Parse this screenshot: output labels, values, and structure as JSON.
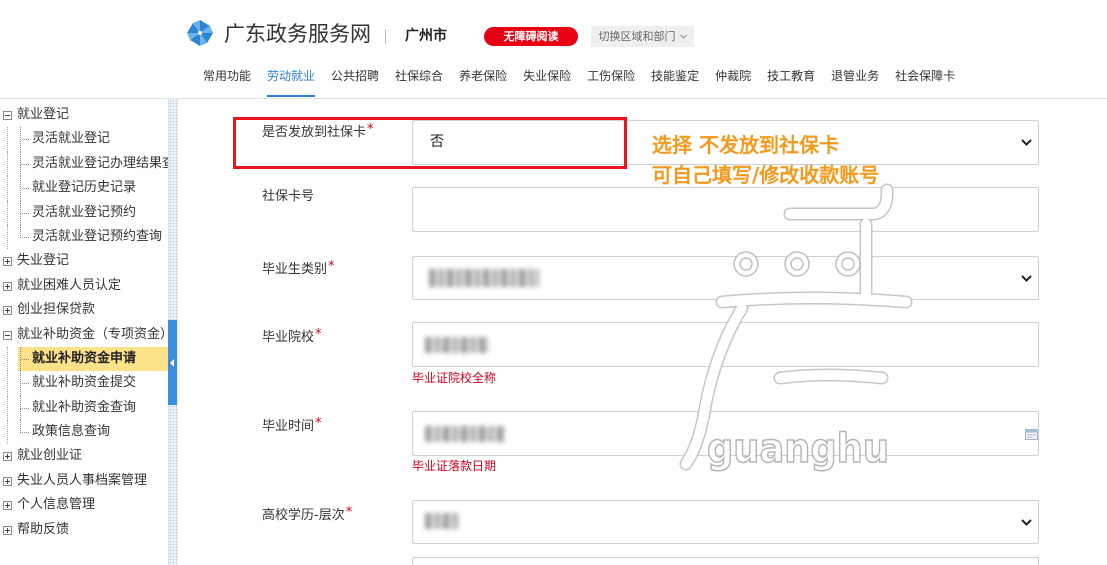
{
  "header": {
    "site_title": "广东政务服务网",
    "city": "广州市",
    "accessibility_label": "无障碍阅读",
    "region_switch_label": "切换区域和部门"
  },
  "nav": {
    "items": [
      "常用功能",
      "劳动就业",
      "公共招聘",
      "社保综合",
      "养老保险",
      "失业保险",
      "工伤保险",
      "技能鉴定",
      "仲裁院",
      "技工教育",
      "退管业务",
      "社会保障卡"
    ],
    "active_index": 1
  },
  "sidebar": {
    "groups": [
      {
        "label": "就业登记",
        "expanded": true,
        "children": [
          "灵活就业登记",
          "灵活就业登记办理结果查",
          "就业登记历史记录",
          "灵活就业登记预约",
          "灵活就业登记预约查询"
        ]
      },
      {
        "label": "失业登记",
        "expanded": false
      },
      {
        "label": "就业困难人员认定",
        "expanded": false
      },
      {
        "label": "创业担保贷款",
        "expanded": false
      },
      {
        "label": "就业补助资金（专项资金）",
        "expanded": true,
        "children": [
          "就业补助资金申请",
          "就业补助资金提交",
          "就业补助资金查询",
          "政策信息查询"
        ],
        "selected_index": 0
      },
      {
        "label": "就业创业证",
        "expanded": false
      },
      {
        "label": "失业人员人事档案管理",
        "expanded": false
      },
      {
        "label": "个人信息管理",
        "expanded": false
      },
      {
        "label": "帮助反馈",
        "expanded": false
      }
    ]
  },
  "form": {
    "required_mark": "*",
    "fields": [
      {
        "label": "是否发放到社保卡",
        "required": true,
        "value": "否"
      },
      {
        "label": "社保卡号",
        "required": false,
        "value": ""
      },
      {
        "label": "毕业生类别",
        "required": true
      },
      {
        "label": "毕业院校",
        "required": true,
        "hint": "毕业证院校全称"
      },
      {
        "label": "毕业时间",
        "required": true,
        "hint": "毕业证落款日期"
      },
      {
        "label": "高校学历-层次",
        "required": true
      }
    ]
  },
  "annotation": {
    "line1": "选择 不发放到社保卡",
    "line2": "可自己填写/修改收款账号"
  },
  "watermark": {
    "text": "guanghu"
  },
  "colors": {
    "accent": "#2f7fd8",
    "accessibility_button": "#e60012",
    "required": "#d0021b",
    "annotation_box": "#e8141f",
    "annotation_text": "#f39a1e",
    "selected_row": "#fde28a",
    "sidebar_tab": "#3b8de0"
  },
  "icons": {
    "logo": "pinwheel-logo-icon",
    "region_switch": "chevron-down-icon",
    "select": "chevron-down-icon",
    "date_picker": "calendar-icon",
    "tree_expanded": "minus-box-icon",
    "tree_collapsed": "plus-box-icon",
    "sidebar_collapse": "triangle-left-icon"
  }
}
